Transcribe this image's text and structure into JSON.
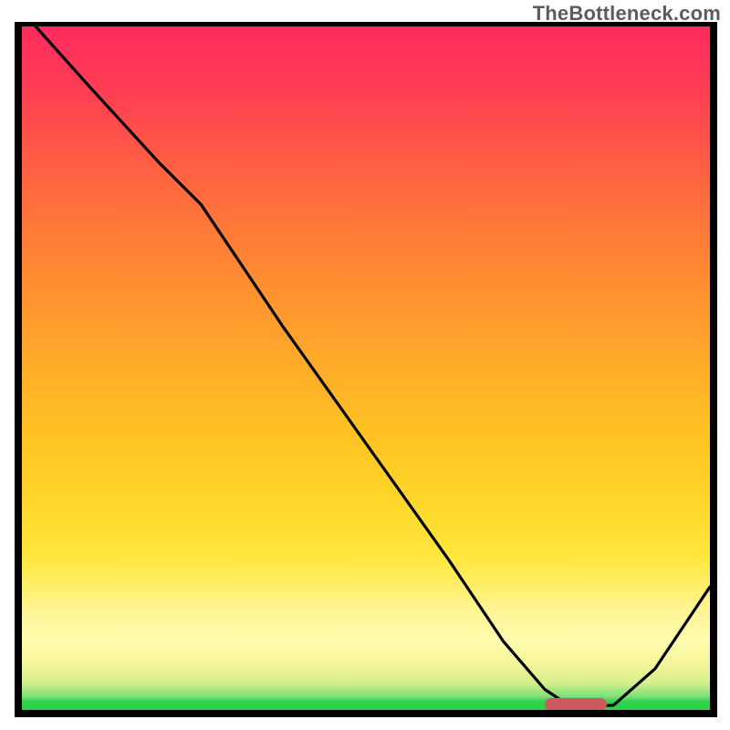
{
  "watermark": "TheBottleneck.com",
  "colors": {
    "frame": "#000000",
    "curve": "#000000",
    "marker": "#cc5a5e",
    "gradient_top": "#ff2b5f",
    "gradient_mid": "#ffd82a",
    "gradient_bottom": "#2fd24b"
  },
  "chart_data": {
    "type": "line",
    "title": "",
    "xlabel": "",
    "ylabel": "",
    "xlim": [
      0,
      100
    ],
    "ylim": [
      0,
      100
    ],
    "grid": false,
    "series": [
      {
        "name": "bottleneck-curve",
        "x": [
          2,
          10,
          20,
          26,
          38,
          50,
          62,
          70,
          76,
          79,
          82,
          86,
          92,
          100
        ],
        "y": [
          100,
          91,
          80,
          74,
          56,
          39,
          22,
          10,
          3,
          1,
          0.5,
          0.7,
          6,
          18
        ]
      }
    ],
    "annotations": [
      {
        "name": "optimal-range-marker",
        "x_start": 76,
        "x_end": 85,
        "y": 0.8
      }
    ],
    "legend": false
  }
}
